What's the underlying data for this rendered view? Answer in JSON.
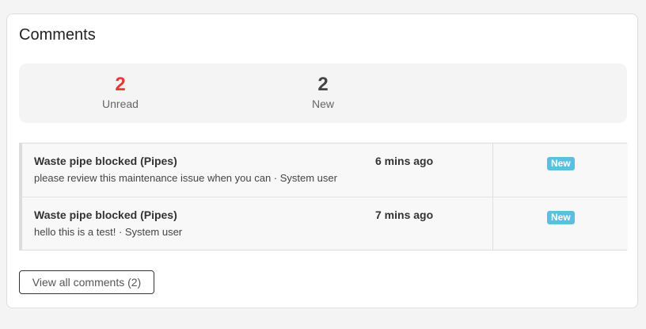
{
  "card": {
    "title": "Comments"
  },
  "stats": {
    "unread": {
      "value": "2",
      "label": "Unread",
      "color": "#e53935"
    },
    "new": {
      "value": "2",
      "label": "New",
      "color": "#444444"
    }
  },
  "comments": [
    {
      "title": "Waste pipe blocked (Pipes)",
      "time": "6 mins ago",
      "subtitle": "please review this maintenance issue when you can · System user",
      "badge": "New"
    },
    {
      "title": "Waste pipe blocked (Pipes)",
      "time": "7 mins ago",
      "subtitle": "hello this is a test! · System user",
      "badge": "New"
    }
  ],
  "footer": {
    "view_all_label": "View all comments (2)"
  },
  "colors": {
    "badge": "#5bc0de",
    "unread": "#e53935"
  }
}
